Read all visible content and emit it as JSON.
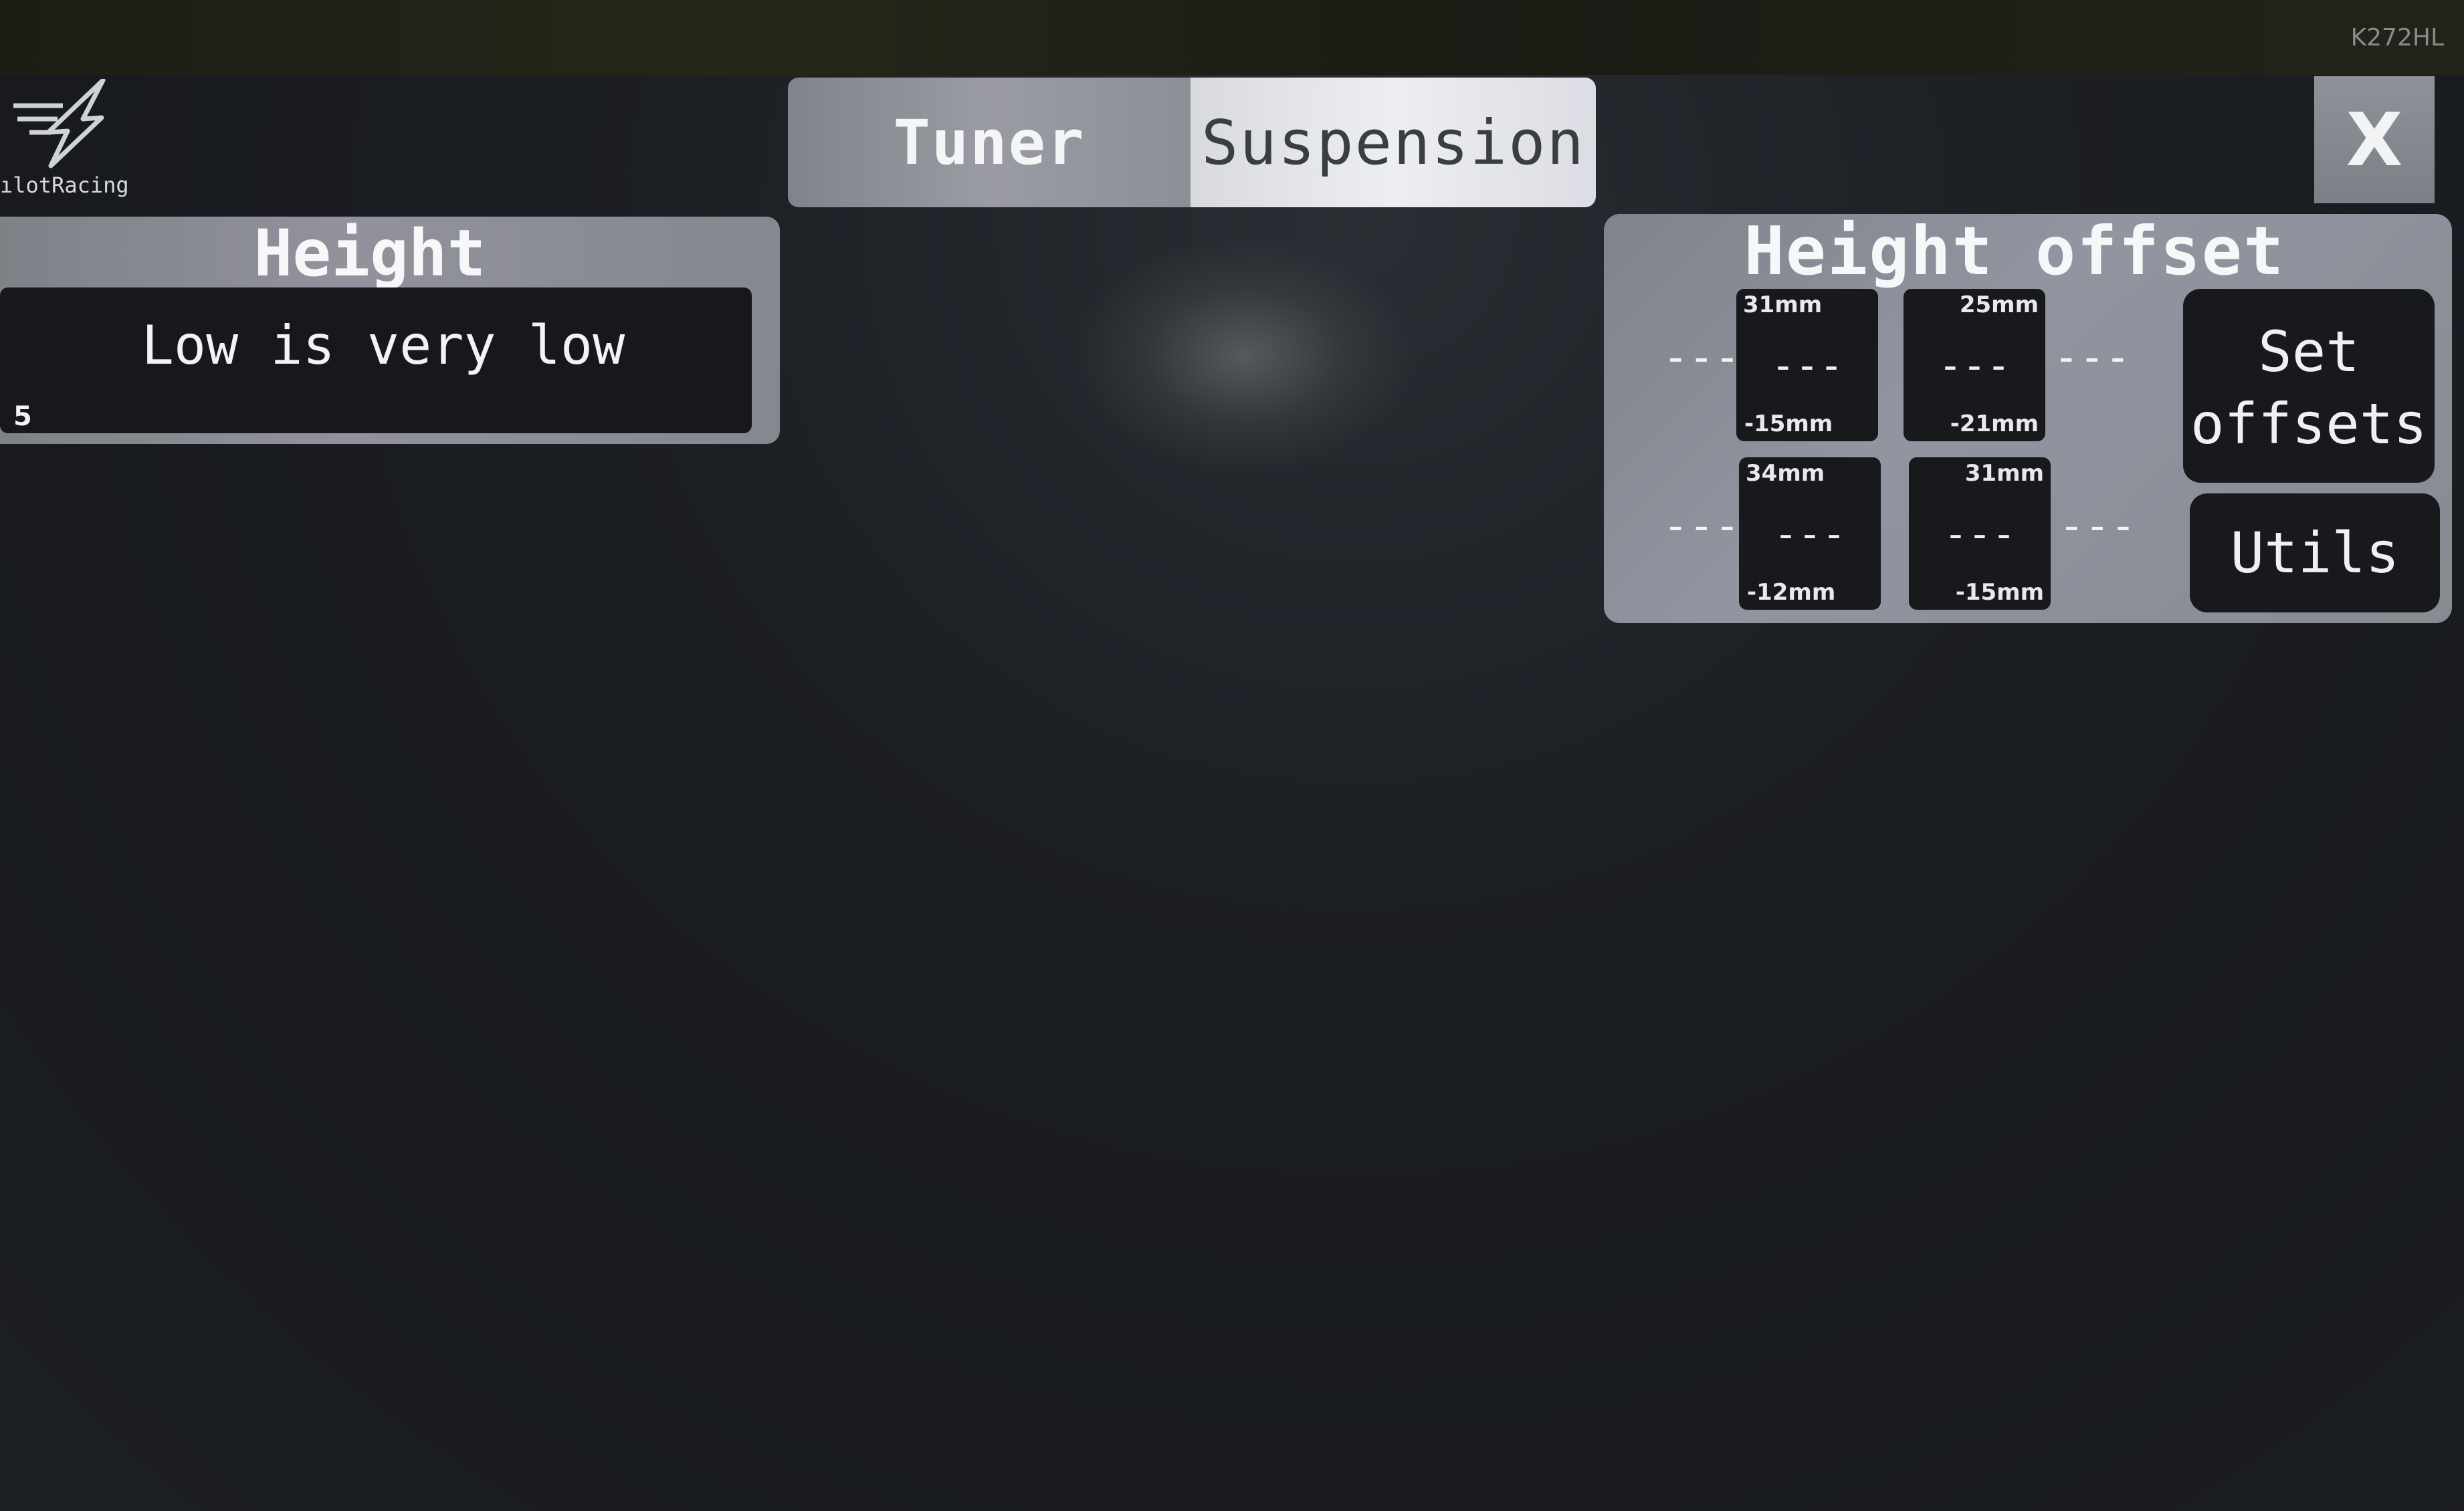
{
  "device": {
    "model_label": "K272HL"
  },
  "logo": {
    "text": "ılotRacing"
  },
  "tabs": [
    {
      "label": "Tuner",
      "active": false
    },
    {
      "label": "Suspension",
      "active": true
    }
  ],
  "close_label": "X",
  "height_panel": {
    "title": "Height",
    "value": "Low is very low",
    "left_value": "5"
  },
  "offset_panel": {
    "title": "Height offset",
    "side_placeholder": "---",
    "cells": [
      {
        "top": "31mm",
        "value": "---",
        "bottom": "-15mm"
      },
      {
        "top": "25mm",
        "value": "---",
        "bottom": "-21mm"
      },
      {
        "top": "34mm",
        "value": "---",
        "bottom": "-12mm"
      },
      {
        "top": "31mm",
        "value": "---",
        "bottom": "-15mm"
      }
    ],
    "set_offsets_line1": "Set",
    "set_offsets_line2": "offsets",
    "utils_label": "Utils"
  },
  "colors": {
    "accent_panel": "#92929d",
    "active_tab": "#eceef2",
    "background": "#181a1f"
  }
}
